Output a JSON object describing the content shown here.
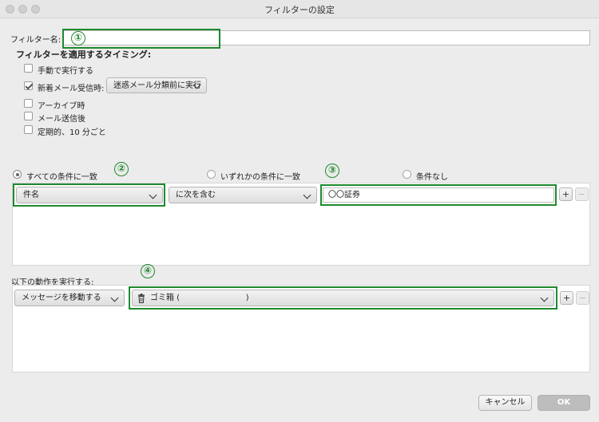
{
  "window": {
    "title": "フィルターの設定"
  },
  "filter_name": {
    "label": "フィルター名:",
    "value": ""
  },
  "timing": {
    "heading": "フィルターを適用するタイミング:",
    "options": [
      {
        "label": "手動で実行する",
        "checked": false
      },
      {
        "label": "新着メール受信時:",
        "checked": true,
        "select": "迷惑メール分類前に実行"
      },
      {
        "label": "アーカイブ時",
        "checked": false
      },
      {
        "label": "メール送信後",
        "checked": false
      },
      {
        "label": "定期的、10 分ごと",
        "checked": false
      }
    ]
  },
  "match": {
    "options": [
      {
        "label": "すべての条件に一致",
        "selected": true
      },
      {
        "label": "いずれかの条件に一致",
        "selected": false
      },
      {
        "label": "条件なし",
        "selected": false
      }
    ]
  },
  "condition": {
    "field": "件名",
    "operator": "に次を含む",
    "value": "〇〇証券",
    "add_label": "+",
    "remove_label": "−"
  },
  "actions": {
    "heading": "以下の動作を実行する:",
    "action": "メッセージを移動する",
    "target": "ゴミ箱 (                          )",
    "add_label": "+",
    "remove_label": "−"
  },
  "annotations": [
    "①",
    "②",
    "③",
    "④"
  ],
  "footer": {
    "cancel": "キャンセル",
    "ok": "OK"
  },
  "colors": {
    "annotation": "#1e8a2e",
    "ok_button": "#bdbdbd"
  }
}
